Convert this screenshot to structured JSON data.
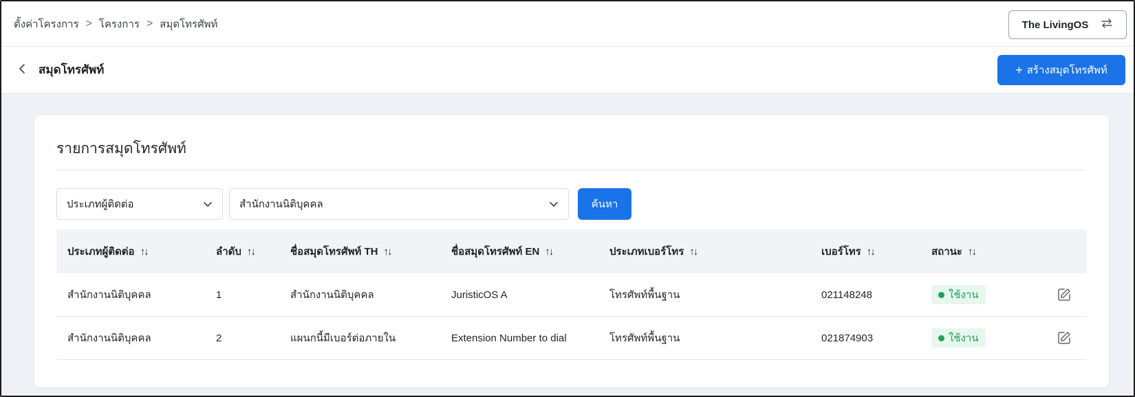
{
  "breadcrumb": {
    "items": [
      "ตั้งค่าโครงการ",
      "โครงการ",
      "สมุดโทรศัพท์"
    ],
    "separator": ">"
  },
  "project_switcher": {
    "label": "The LivingOS",
    "icon": "swap-icon"
  },
  "header": {
    "title": "สมุดโทรศัพท์",
    "back_icon": "chevron-left-icon",
    "create_button": {
      "plus": "+",
      "label": "สร้างสมุดโทรศัพท์"
    }
  },
  "card": {
    "title": "รายการสมุดโทรศัพท์",
    "filters": {
      "contact_type": {
        "value": "ประเภทผู้ติดต่อ"
      },
      "department": {
        "value": "สำนักงานนิติบุคคล"
      },
      "search_label": "ค้นหา"
    },
    "table": {
      "sort_glyph": "↑↓",
      "columns": [
        "ประเภทผู้ติดต่อ",
        "ลำดับ",
        "ชื่อสมุดโทรศัพท์ TH",
        "ชื่อสมุดโทรศัพท์ EN",
        "ประเภทเบอร์โทร",
        "เบอร์โทร",
        "สถานะ"
      ],
      "rows": [
        {
          "contact_type": "สำนักงานนิติบุคคล",
          "order": "1",
          "name_th": "สำนักงานนิติบุคคล",
          "name_en": "JuristicOS A",
          "phone_type": "โทรศัพท์พื้นฐาน",
          "phone": "021148248",
          "status": "ใช้งาน"
        },
        {
          "contact_type": "สำนักงานนิติบุคคล",
          "order": "2",
          "name_th": "แผนกนี้มีเบอร์ต่อภายใน",
          "name_en": "Extension Number to dial",
          "phone_type": "โทรศัพท์พื้นฐาน",
          "phone": "021874903",
          "status": "ใช้งาน"
        }
      ]
    }
  },
  "colors": {
    "primary": "#1a73e8",
    "status_active_text": "#1aa35a",
    "status_active_bg": "#e8f7ee",
    "page_bg": "#eef1f5",
    "table_header_bg": "#f1f3f6"
  }
}
